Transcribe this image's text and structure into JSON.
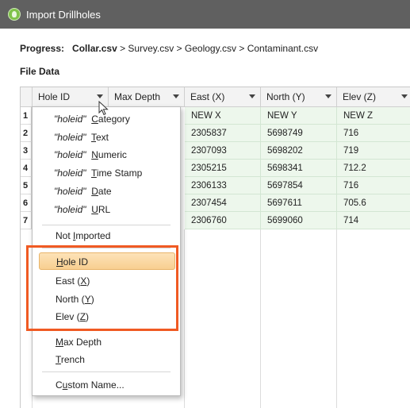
{
  "window": {
    "title": "Import Drillholes"
  },
  "progress": {
    "label": "Progress:",
    "current": "Collar.csv",
    "steps_rest": " > Survey.csv > Geology.csv > Contaminant.csv"
  },
  "file_data": {
    "heading": "File Data"
  },
  "table": {
    "headers": [
      "Hole ID",
      "Max Depth",
      "East (X)",
      "North (Y)",
      "Elev (Z)"
    ],
    "row_numbers": [
      "1",
      "2",
      "3",
      "4",
      "5",
      "6",
      "7"
    ],
    "rows": [
      [
        "NEW X",
        "NEW Y",
        "NEW Z"
      ],
      [
        "2305837",
        "5698749",
        "716"
      ],
      [
        "2307093",
        "5698202",
        "719"
      ],
      [
        "2305215",
        "5698341",
        "712.2"
      ],
      [
        "2306133",
        "5697854",
        "716"
      ],
      [
        "2307454",
        "5697611",
        "705.6"
      ],
      [
        "2306760",
        "5699060",
        "714"
      ]
    ]
  },
  "menu": {
    "quoted_prefix": "\"holeid\"",
    "typed_items": [
      {
        "pre": "",
        "u": "C",
        "post": "ategory"
      },
      {
        "pre": "",
        "u": "T",
        "post": "ext"
      },
      {
        "pre": "",
        "u": "N",
        "post": "umeric"
      },
      {
        "pre": "",
        "u": "T",
        "post": "ime Stamp"
      },
      {
        "pre": "",
        "u": "D",
        "post": "ate"
      },
      {
        "pre": "",
        "u": "U",
        "post": "RL"
      }
    ],
    "not_imported": {
      "pre": "Not ",
      "u": "I",
      "post": "mported"
    },
    "hole_id": {
      "pre": "",
      "u": "H",
      "post": "ole ID"
    },
    "east": {
      "pre": "East (",
      "u": "X",
      "post": ")"
    },
    "north": {
      "pre": "North (",
      "u": "Y",
      "post": ")"
    },
    "elev": {
      "pre": "Elev (",
      "u": "Z",
      "post": ")"
    },
    "max_depth": {
      "pre": "",
      "u": "M",
      "post": "ax Depth"
    },
    "trench": {
      "pre": "",
      "u": "T",
      "post": "rench"
    },
    "custom_name": {
      "pre": "C",
      "u": "u",
      "post": "stom Name..."
    }
  },
  "colors": {
    "highlight_border": "#f05a23",
    "selected_item": "#f8cf90",
    "title_bar": "#606060",
    "data_cell": "#edf7ec"
  }
}
